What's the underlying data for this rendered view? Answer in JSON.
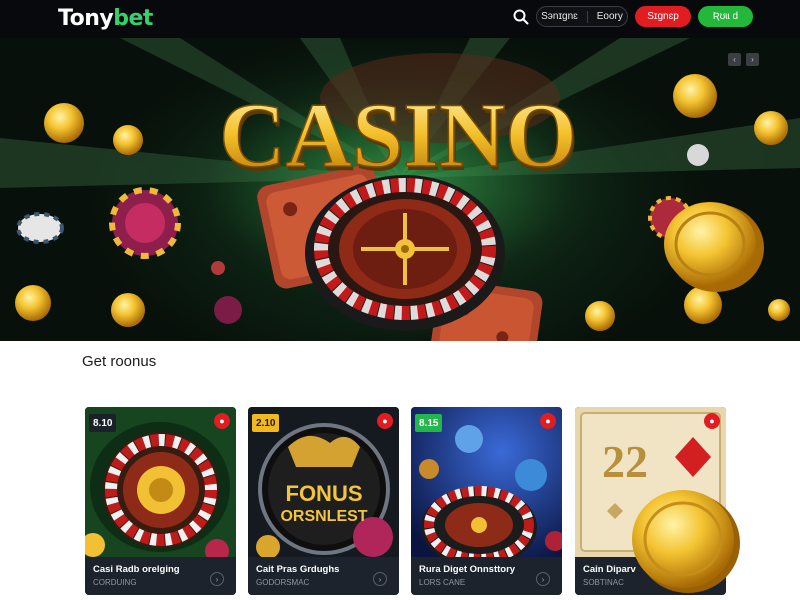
{
  "header": {
    "logo_part1": "Tony",
    "logo_part2": "bet",
    "nav_pill_left": "Sэnɪɡnɛ",
    "nav_pill_right": "Eoory",
    "signup_label": "Sɪgnɛp",
    "login_label": "Ʀʊɩɩ d"
  },
  "hero": {
    "title": "CASINO"
  },
  "section": {
    "title": "Get roonus"
  },
  "cards": [
    {
      "badge": "8.10",
      "title": "Casi Radb orelging",
      "subtitle": "CORDUING",
      "art_text1": "",
      "art_text2": ""
    },
    {
      "badge": "2.10",
      "title": "Cait Pras Grdughs",
      "subtitle": "GODORSMAC",
      "art_text1": "FONUS",
      "art_text2": "ORSNLEST"
    },
    {
      "badge": "8.15",
      "title": "Rura Diget Onnsttory",
      "subtitle": "LORS CANE",
      "art_text1": "",
      "art_text2": ""
    },
    {
      "badge": "",
      "title": "Cain Diparv",
      "subtitle": "SOBTINAC",
      "art_text1": "22",
      "art_text2": ""
    }
  ],
  "colors": {
    "brand_green": "#33d26a",
    "signup_red": "#e21d22",
    "login_green": "#24b83a",
    "header_bg": "#07090c"
  },
  "icons": [
    "search-icon",
    "hero-control-icon",
    "favorite-icon",
    "chevron-right-icon"
  ]
}
